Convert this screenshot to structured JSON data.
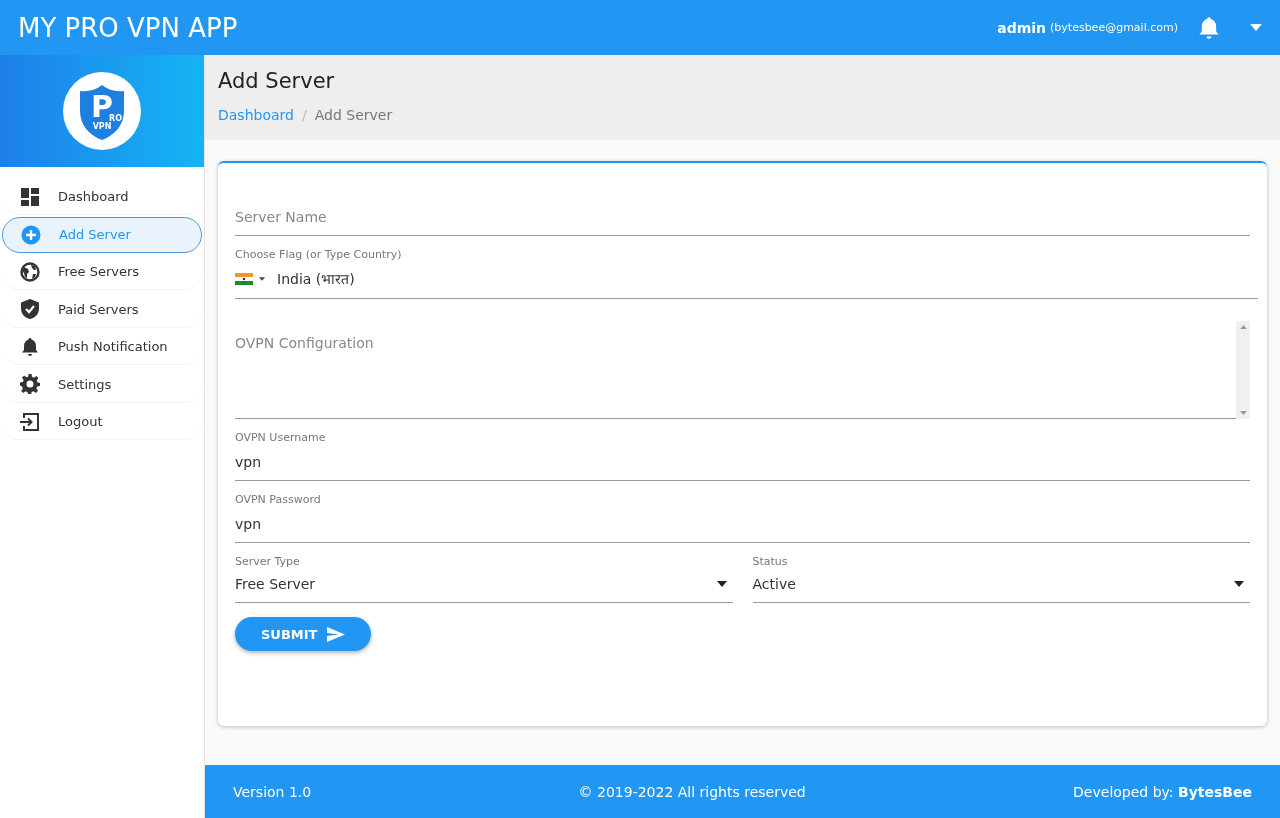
{
  "header": {
    "title": "MY PRO VPN APP",
    "user": "admin",
    "email": "(bytesbee@gmail.com)"
  },
  "logo": {
    "letter": "P",
    "small": "RO",
    "sub": "VPN"
  },
  "sidebar": {
    "items": [
      {
        "label": "Dashboard",
        "kind": "dashboard",
        "selected": false
      },
      {
        "label": "Add Server",
        "kind": "add",
        "selected": true
      },
      {
        "label": "Free Servers",
        "kind": "globe",
        "selected": false
      },
      {
        "label": "Paid Servers",
        "kind": "shield",
        "selected": false
      },
      {
        "label": "Push Notification",
        "kind": "bell",
        "selected": false
      },
      {
        "label": "Settings",
        "kind": "gear",
        "selected": false
      },
      {
        "label": "Logout",
        "kind": "logout",
        "selected": false
      }
    ]
  },
  "page": {
    "title": "Add Server",
    "separator": "/",
    "breadcrumb": [
      {
        "label": "Dashboard",
        "kind": "link"
      },
      {
        "label": "Add Server",
        "kind": "current"
      }
    ]
  },
  "form": {
    "fields": [
      {
        "kind": "text",
        "placeholder": "Server Name"
      },
      {
        "kind": "country",
        "label": "Choose Flag (or Type Country)",
        "value": "India (भारत)"
      },
      {
        "kind": "textarea",
        "placeholder": "OVPN Configuration"
      },
      {
        "kind": "text",
        "label": "OVPN Username",
        "value": "vpn"
      },
      {
        "kind": "text",
        "label": "OVPN Password",
        "value": "vpn"
      }
    ],
    "selects": [
      {
        "label": "Server Type",
        "value": "Free Server"
      },
      {
        "label": "Status",
        "value": "Active"
      }
    ],
    "submit": "SUBMIT"
  },
  "footer": {
    "version": "Version 1.0",
    "copyright": "© 2019-2022 All rights reserved",
    "credit": "Developed by: **BytesBee**"
  }
}
